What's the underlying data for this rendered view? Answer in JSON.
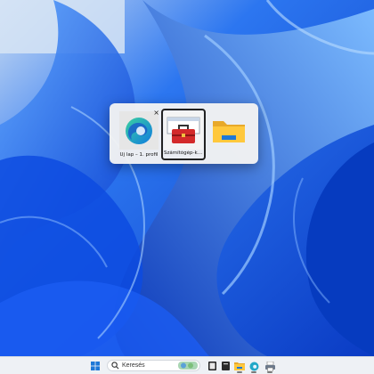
{
  "switcher": {
    "items": [
      {
        "label": "Új lap – 1. profil",
        "icon": "edge-icon",
        "selected": false,
        "has_close": true
      },
      {
        "label": "Számítógép-karbantartás",
        "icon": "toolbox-icon",
        "selected": true,
        "has_close": false
      },
      {
        "label": "",
        "icon": "folder-icon",
        "selected": false,
        "has_close": false
      }
    ],
    "close_glyph": "×"
  },
  "taskbar": {
    "search_placeholder": "Keresés",
    "apps": [
      "start-icon",
      "search-icon",
      "widget-icon",
      "terminal-icon",
      "file-explorer-icon",
      "edge-icon",
      "printer-icon"
    ]
  },
  "colors": {
    "wallpaper_base": "#0a44d8",
    "taskbar_bg": "#eef1f5",
    "windows_blue": "#1e78d7"
  }
}
